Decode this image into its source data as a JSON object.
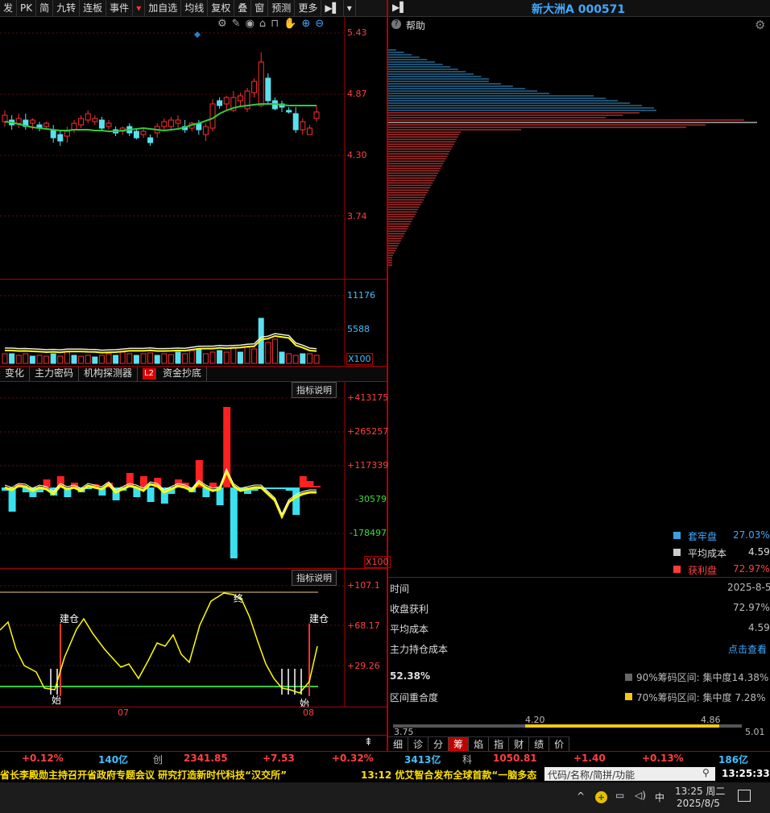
{
  "toolbar": [
    "发",
    "PK",
    "简",
    "九转",
    "连板",
    "事件",
    "加自选",
    "均线",
    "复权",
    "叠",
    "窗",
    "预测",
    "更多"
  ],
  "stock_title": "新大洲A 000571",
  "help_label": "帮助",
  "price_axis": [
    "5.43",
    "4.87",
    "4.30",
    "3.74"
  ],
  "volume_axis": [
    "11176",
    "5588",
    "X100"
  ],
  "indicator_tabs": [
    "变化",
    "主力密码",
    "机构探测器",
    "L2",
    "资金抄底"
  ],
  "indicator_btn": "指标说明",
  "mid_axis": [
    "+413175",
    "+265257",
    "+117339",
    "-30579",
    "-178497",
    "X100"
  ],
  "low_axis": [
    "+107.1",
    "+68.17",
    "+29.26"
  ],
  "low_marks": {
    "build1": "建仓",
    "build2": "建仓",
    "end": "终",
    "start1": "始",
    "start2": "始"
  },
  "date_labels": [
    "07",
    "08"
  ],
  "chip_legend": [
    {
      "label": "套牢盘",
      "value": "27.03%",
      "color": "#3aa0e0"
    },
    {
      "label": "平均成本",
      "value": "4.59",
      "color": "#cccccc"
    },
    {
      "label": "获利盘",
      "value": "72.97%",
      "color": "#ff3b3b"
    }
  ],
  "info": {
    "time_label": "时间",
    "time_value": "2025-8-5",
    "profit_label": "收盘获利",
    "profit_value": "72.97%",
    "avg_label": "平均成本",
    "avg_value": "4.59",
    "main_label": "主力持仓成本",
    "main_value": "点击查看",
    "overlap_value": "52.38%",
    "overlap_label": "区间重合度",
    "r90": "90%筹码区间: 集中度14.38%",
    "r70": "70%筹码区间: 集中度 7.28%",
    "range_ticks": [
      "3.75",
      "4.20",
      "4.86",
      "5.01"
    ]
  },
  "bottom_tabs": [
    "细",
    "诊",
    "分",
    "筹",
    "焰",
    "指",
    "财",
    "绩",
    "价"
  ],
  "market": [
    {
      "text": "+0.12%",
      "color": "#ff4040"
    },
    {
      "text": "140亿",
      "color": "#40c0ff"
    },
    {
      "text": "创",
      "color": "#bbbbbb"
    },
    {
      "text": "2341.85",
      "color": "#ff4040"
    },
    {
      "text": "+7.53",
      "color": "#ff4040"
    },
    {
      "text": "+0.32%",
      "color": "#ff4040"
    },
    {
      "text": "3413亿",
      "color": "#40c0ff"
    },
    {
      "text": "科",
      "color": "#bbbbbb"
    },
    {
      "text": "1050.81",
      "color": "#ff4040"
    },
    {
      "text": "+1.40",
      "color": "#ff4040"
    },
    {
      "text": "+0.13%",
      "color": "#ff4040"
    },
    {
      "text": "186亿",
      "color": "#40c0ff"
    }
  ],
  "ticker": "省长李殿勋主持召开省政府专题会议 研究打造新时代科技“汉交所”",
  "ticker2": "13:12 优艾智合发布全球首款“一脑多态",
  "search_placeholder": "代码/名称/简拼/功能",
  "clock": "13:25:33",
  "taskbar": {
    "ime": "中",
    "time": "13:25 周二",
    "date": "2025/8/5"
  }
}
